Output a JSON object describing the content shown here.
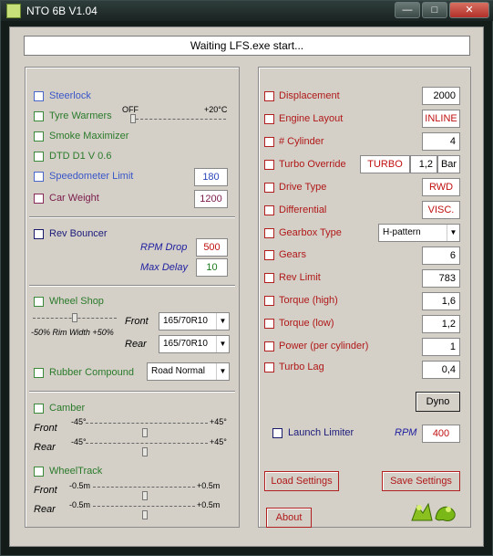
{
  "window": {
    "title": "NTO 6B V1.04",
    "minimize": "—",
    "maximize": "□",
    "close": "✕"
  },
  "status": "Waiting LFS.exe start...",
  "left": {
    "steerlock": "Steerlock",
    "tyre_warmers": "Tyre Warmers",
    "tyre_off": "OFF",
    "tyre_on": "+20°C",
    "smoke": "Smoke Maximizer",
    "dtd": "DTD D1 V 0.6",
    "speedo": "Speedometer Limit",
    "speedo_val": "180",
    "weight": "Car Weight",
    "weight_val": "1200",
    "rev_bouncer": "Rev Bouncer",
    "rpm_drop": "RPM Drop",
    "rpm_drop_val": "500",
    "max_delay": "Max Delay",
    "max_delay_val": "10",
    "wheel_shop": "Wheel Shop",
    "rim_width": "-50% Rim Width +50%",
    "front": "Front",
    "rear": "Rear",
    "front_tyre": "165/70R10",
    "rear_tyre": "165/70R10",
    "rubber": "Rubber Compound",
    "rubber_val": "Road Normal",
    "camber": "Camber",
    "camber_front_min": "-45°",
    "camber_front_max": "+45°",
    "camber_rear_min": "-45°",
    "camber_rear_max": "+45°",
    "wheeltrack": "WheelTrack",
    "wt_front_min": "-0.5m",
    "wt_front_max": "+0.5m",
    "wt_rear_min": "-0.5m",
    "wt_rear_max": "+0.5m"
  },
  "right": {
    "displacement": "Displacement",
    "displacement_val": "2000",
    "engine_layout": "Engine Layout",
    "engine_layout_val": "INLINE",
    "cylinder": "# Cylinder",
    "cylinder_val": "4",
    "turbo_override": "Turbo Override",
    "turbo_val": "TURBO",
    "turbo_bar_val": "1,2",
    "turbo_unit": "Bar",
    "drive_type": "Drive Type",
    "drive_type_val": "RWD",
    "differential": "Differential",
    "differential_val": "VISC.",
    "gearbox": "Gearbox Type",
    "gearbox_val": "H-pattern",
    "gears": "Gears",
    "gears_val": "6",
    "rev_limit": "Rev Limit",
    "rev_limit_val": "783",
    "torque_high": "Torque (high)",
    "torque_high_val": "1,6",
    "torque_low": "Torque (low)",
    "torque_low_val": "1,2",
    "power": "Power (per cylinder)",
    "power_val": "1",
    "turbo_lag": "Turbo Lag",
    "turbo_lag_val": "0,4",
    "dyno": "Dyno",
    "launch_limiter": "Launch Limiter",
    "rpm": "RPM",
    "launch_val": "400",
    "load": "Load Settings",
    "save": "Save Settings",
    "about": "About"
  },
  "sliders": {
    "tyre_warmers_level": 0.0,
    "rim_width_level": 0.5,
    "camber_front_level": 0.5,
    "camber_rear_level": 0.5,
    "wt_front_level": 0.5,
    "wt_rear_level": 0.5
  },
  "logo_icon": "frog-icon"
}
